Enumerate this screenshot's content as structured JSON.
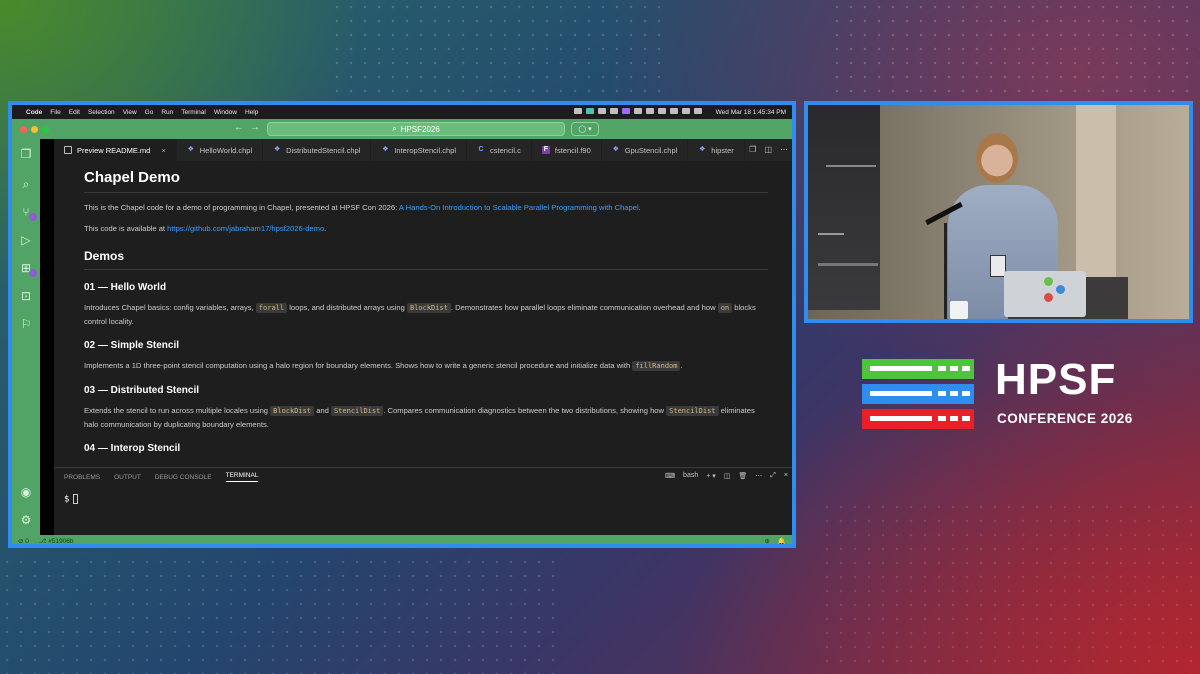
{
  "menubar": {
    "app": "Code",
    "items": [
      "File",
      "Edit",
      "Selection",
      "View",
      "Go",
      "Run",
      "Terminal",
      "Window",
      "Help"
    ],
    "clock": "Wed Mar 18  1:45:34 PM"
  },
  "titlebar": {
    "search": "HPSF2026"
  },
  "tabs": [
    {
      "label": "Preview README.md",
      "icon": "preview-icon"
    },
    {
      "label": "HelloWorld.chpl",
      "icon": "chapel-file-icon"
    },
    {
      "label": "DistributedStencil.chpl",
      "icon": "chapel-file-icon"
    },
    {
      "label": "InteropStencil.chpl",
      "icon": "chapel-file-icon"
    },
    {
      "label": "cstencil.c",
      "icon": "c-file-icon"
    },
    {
      "label": "fstencil.f90",
      "icon": "fortran-file-icon"
    },
    {
      "label": "GpuStencil.chpl",
      "icon": "chapel-file-icon"
    },
    {
      "label": "hipster",
      "icon": "chapel-file-icon"
    }
  ],
  "doc": {
    "title": "Chapel Demo",
    "intro_before": "This is the Chapel code for a demo of programming in Chapel, presented at HPSF Con 2026: ",
    "intro_link": "A Hands-On Introduction to Scalable Parallel Programming with Chapel",
    "intro_after": ".",
    "avail_before": "This code is available at ",
    "avail_link": "https://github.com/jabraham17/hpsf2026-demo",
    "avail_after": ".",
    "demos_heading": "Demos",
    "s1": {
      "title": "01 — Hello World",
      "p1": "Introduces Chapel basics: config variables, arrays, ",
      "c1": "forall",
      "p2": " loops, and distributed arrays using ",
      "c2": "BlockDist",
      "p3": ". Demonstrates how parallel loops eliminate communication overhead and how ",
      "c3": "on",
      "p4": " blocks control locality."
    },
    "s2": {
      "title": "02 — Simple Stencil",
      "p1": "Implements a 1D three-point stencil computation using a halo region for boundary elements. Shows how to write a generic stencil procedure and initialize data with ",
      "c1": "fillRandom",
      "p2": "."
    },
    "s3": {
      "title": "03 — Distributed Stencil",
      "p1": "Extends the stencil to run across multiple locales using ",
      "c1": "BlockDist",
      "p2": " and ",
      "c2": "StencilDist",
      "p3": ". Compares communication diagnostics between the two distributions, showing how ",
      "c3": "StencilDist",
      "p4": " eliminates halo communication by duplicating boundary elements."
    },
    "s4": {
      "title": "04 — Interop Stencil"
    }
  },
  "panel": {
    "tabs": [
      "PROBLEMS",
      "OUTPUT",
      "DEBUG CONSOLE",
      "TERMINAL"
    ],
    "active": "TERMINAL",
    "shell": "bash",
    "prompt": "$"
  },
  "statusbar": {
    "ports": "0",
    "branch": "#51906b"
  },
  "logo": {
    "title": "HPSF",
    "subtitle": "CONFERENCE 2026",
    "colors": [
      "#4cc53a",
      "#2f8df0",
      "#e8202a"
    ]
  }
}
